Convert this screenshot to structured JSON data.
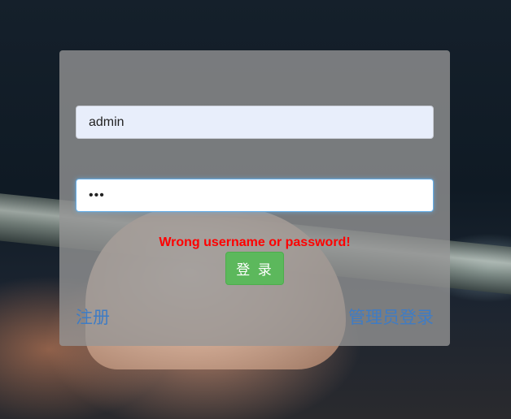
{
  "login_form": {
    "username_value": "admin",
    "password_value": "•••",
    "error_message": "Wrong username or password!",
    "login_button_label": "登 录",
    "register_link_label": "注册",
    "admin_login_link_label": "管理员登录"
  },
  "colors": {
    "error": "#ff0000",
    "button": "#5cb85c",
    "link": "#3f7cc4"
  }
}
